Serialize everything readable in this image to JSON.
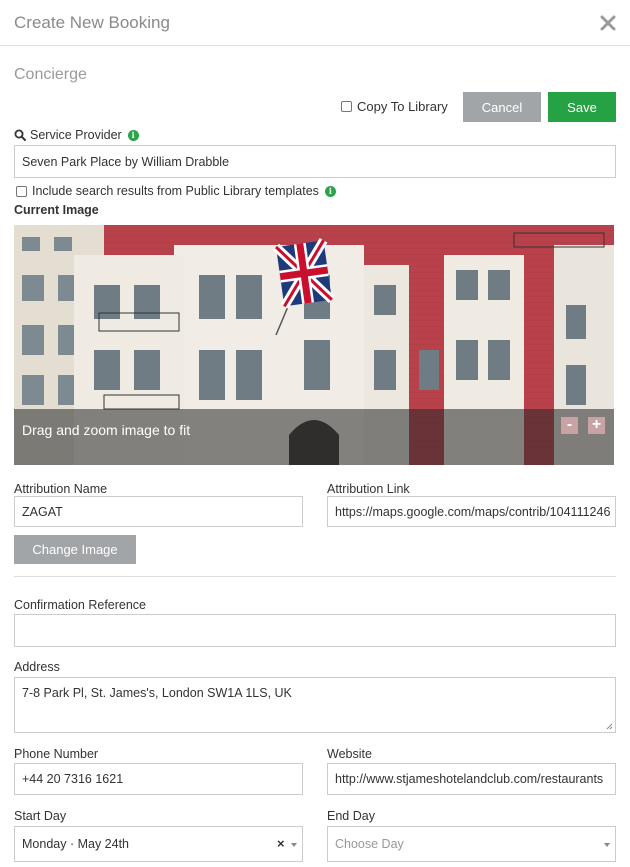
{
  "header": {
    "title": "Create New Booking",
    "close_icon": "close-icon"
  },
  "section": {
    "title": "Concierge"
  },
  "actions": {
    "copy_to_library": "Copy To Library",
    "copy_checked": false,
    "cancel": "Cancel",
    "save": "Save"
  },
  "service_provider": {
    "label": "Service Provider",
    "value": "Seven Park Place by William Drabble"
  },
  "public_library": {
    "label": "Include search results from Public Library templates",
    "checked": false
  },
  "image": {
    "label": "Current Image",
    "overlay_text": "Drag and zoom image to fit",
    "zoom_out": "-",
    "zoom_in": "+"
  },
  "attribution": {
    "name_label": "Attribution Name",
    "name_value": "ZAGAT",
    "link_label": "Attribution Link",
    "link_value": "https://maps.google.com/maps/contrib/104111246"
  },
  "change_image": "Change Image",
  "confirmation": {
    "label": "Confirmation Reference",
    "value": ""
  },
  "address": {
    "label": "Address",
    "value": "7-8 Park Pl, St. James's, London SW1A 1LS, UK"
  },
  "phone": {
    "label": "Phone Number",
    "value": "+44 20 7316 1621"
  },
  "website": {
    "label": "Website",
    "value": "http://www.stjameshotelandclub.com/restaurants"
  },
  "start_day": {
    "label": "Start Day",
    "value": "Monday · May 24th",
    "clear": "×"
  },
  "end_day": {
    "label": "End Day",
    "placeholder": "Choose Day"
  },
  "colors": {
    "save": "#25a244",
    "cancel": "#a2a5a8",
    "info": "#2aa34a"
  }
}
